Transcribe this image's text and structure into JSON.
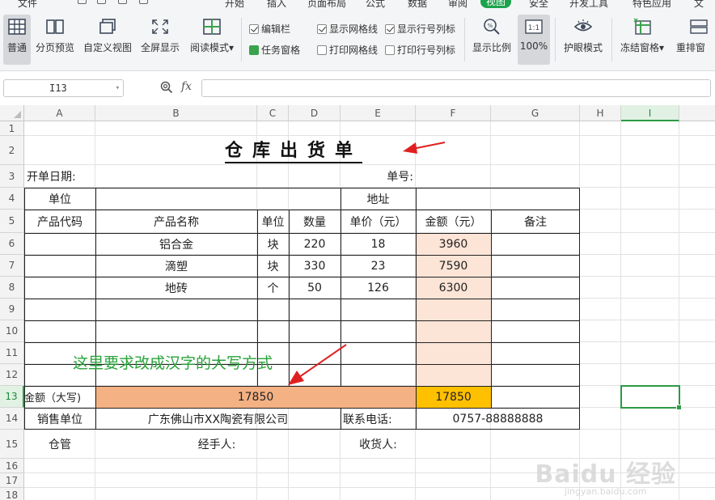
{
  "menu": {
    "tabs": [
      "文件",
      "开始",
      "插入",
      "页面布局",
      "公式",
      "数据",
      "审阅",
      "视图",
      "安全",
      "开发工具",
      "特色应用",
      "文"
    ],
    "active_tab": "视图"
  },
  "ribbon": {
    "view_normal": "普通",
    "page_break_preview": "分页预览",
    "custom_view": "自定义视图",
    "full_screen": "全屏显示",
    "reading_mode": "阅读模式",
    "formula_bar": "编辑栏",
    "task_pane": "任务窗格",
    "show_gridlines": "显示网格线",
    "print_gridlines": "打印网格线",
    "show_headings": "显示行号列标",
    "print_headings": "打印行号列标",
    "zoom": "显示比例",
    "zoom_100": "100%",
    "eye_protection": "护眼模式",
    "freeze_panes": "冻结窗格",
    "arrange": "重排窗"
  },
  "formula_bar": {
    "cell_ref": "I13",
    "fx": "fx",
    "value": ""
  },
  "columns": [
    "A",
    "B",
    "C",
    "D",
    "E",
    "F",
    "G",
    "H",
    "I"
  ],
  "rows": [
    "1",
    "2",
    "3",
    "4",
    "5",
    "6",
    "7",
    "8",
    "9",
    "10",
    "11",
    "12",
    "13",
    "14",
    "15",
    "16",
    "17",
    "18"
  ],
  "sheet": {
    "title": "仓库出货单",
    "open_date_label": "开单日期:",
    "order_no_label": "单号:",
    "unit_label": "单位",
    "address_label": "地址",
    "headers": [
      "产品代码",
      "产品名称",
      "单位",
      "数量",
      "单价（元）",
      "金额（元）",
      "备注"
    ],
    "items": [
      {
        "name": "铝合金",
        "unit": "块",
        "qty": "220",
        "price": "18",
        "amount": "3960"
      },
      {
        "name": "滴塑",
        "unit": "块",
        "qty": "330",
        "price": "23",
        "amount": "7590"
      },
      {
        "name": "地砖",
        "unit": "个",
        "qty": "50",
        "price": "126",
        "amount": "6300"
      }
    ],
    "total_label": "金额（大写)",
    "total_upper": "17850",
    "total_value": "17850",
    "seller_label": "销售单位",
    "seller_name": "广东佛山市XX陶瓷有限公司",
    "phone_label": "联系电话:",
    "phone": "0757-88888888",
    "keeper_label": "仓管",
    "handler_label": "经手人:",
    "receiver_label": "收货人:"
  },
  "annotation": {
    "note": "这里要求改成汉字的大写方式",
    "arrow_color": "#e02020",
    "note_color": "#2aa33a"
  },
  "watermark": {
    "main": "Baidu 经验",
    "sub": "jingyan.baidu.com"
  },
  "colors": {
    "accent_green": "#1aa34a",
    "peach": "#fce4d6",
    "salmon": "#f4b183",
    "gold": "#ffc000"
  }
}
